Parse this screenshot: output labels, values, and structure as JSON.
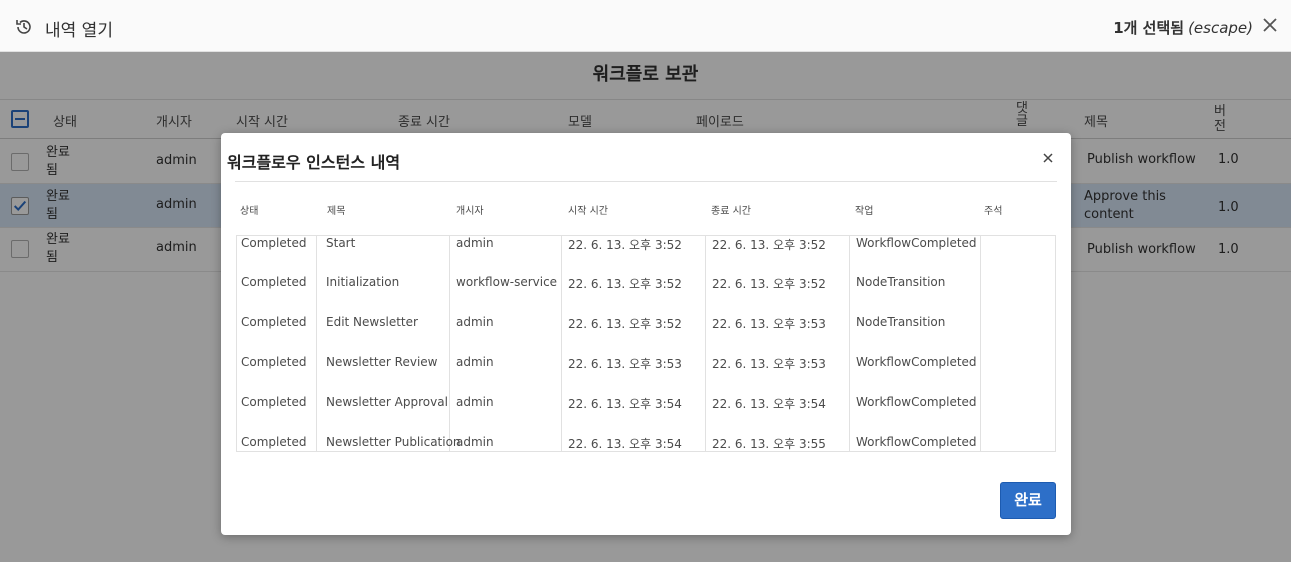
{
  "topbar": {
    "title": "내역 열기",
    "selection": "1개 선택됨",
    "escape": "(escape)"
  },
  "background": {
    "heading": "워크플로 보관",
    "columns": {
      "status": "상태",
      "initiator": "개시자",
      "start": "시작 시간",
      "end": "종료 시간",
      "model": "모델",
      "payload": "페이로드",
      "comments": "댓글",
      "title": "제목",
      "version": "버전"
    },
    "rows": [
      {
        "status": "완료됨",
        "initiator": "admin",
        "title": "Publish workflow",
        "version": "1.0",
        "selected": false
      },
      {
        "status": "완료됨",
        "initiator": "admin",
        "title": "Approve this content",
        "version": "1.0",
        "selected": true
      },
      {
        "status": "완료됨",
        "initiator": "admin",
        "title": "Publish workflow",
        "version": "1.0",
        "selected": false
      }
    ]
  },
  "dialog": {
    "title": "워크플로우 인스턴스 내역",
    "columns": [
      "상태",
      "제목",
      "개시자",
      "시작 시간",
      "종료 시간",
      "작업",
      "주석"
    ],
    "rows": [
      [
        "Completed",
        "Start",
        "admin",
        "22. 6. 13. 오후 3:52",
        "22. 6. 13. 오후 3:52",
        "WorkflowCompleted",
        ""
      ],
      [
        "Completed",
        "Initialization",
        "workflow-service",
        "22. 6. 13. 오후 3:52",
        "22. 6. 13. 오후 3:52",
        "NodeTransition",
        ""
      ],
      [
        "Completed",
        "Edit Newsletter",
        "admin",
        "22. 6. 13. 오후 3:52",
        "22. 6. 13. 오후 3:53",
        "NodeTransition",
        ""
      ],
      [
        "Completed",
        "Newsletter Review",
        "admin",
        "22. 6. 13. 오후 3:53",
        "22. 6. 13. 오후 3:53",
        "WorkflowCompleted",
        ""
      ],
      [
        "Completed",
        "Newsletter Approval",
        "admin",
        "22. 6. 13. 오후 3:54",
        "22. 6. 13. 오후 3:54",
        "WorkflowCompleted",
        ""
      ],
      [
        "Completed",
        "Newsletter Publication",
        "admin",
        "22. 6. 13. 오후 3:54",
        "22. 6. 13. 오후 3:55",
        "WorkflowCompleted",
        ""
      ]
    ],
    "done_label": "완료"
  },
  "colors": {
    "accent": "#2d6fc8",
    "selected_row": "#d8e6f7",
    "overlay": "rgba(0,0,0,0.40)"
  }
}
